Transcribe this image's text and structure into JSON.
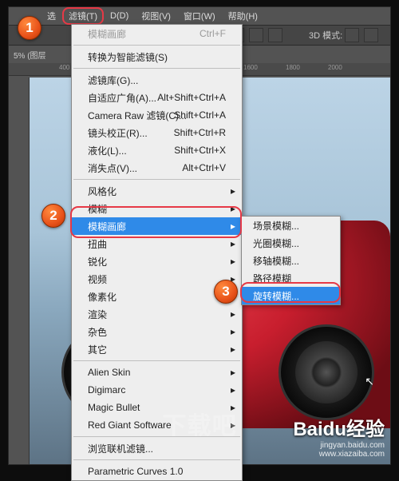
{
  "menubar": {
    "xuan": "选",
    "filter": "滤镜(T)",
    "d": "D(D)",
    "view": "视图(V)",
    "window": "窗口(W)",
    "help": "帮助(H)"
  },
  "toolbar": {
    "mode3d": "3D 模式:"
  },
  "infobar": {
    "zoom": "5% (图层",
    "layer": ""
  },
  "ruler": {
    "t1": "400",
    "t2": "1600",
    "t3": "1800",
    "t4": "2000"
  },
  "menu": {
    "blur_gallery": "模糊画廊",
    "blur_gallery_kb": "Ctrl+F",
    "smart": "转换为智能滤镜(S)",
    "lib": "滤镜库(G)...",
    "wide": "自适应广角(A)...",
    "wide_kb": "Alt+Shift+Ctrl+A",
    "raw": "Camera Raw 滤镜(C)...",
    "raw_kb": "Shift+Ctrl+A",
    "lens": "镜头校正(R)...",
    "lens_kb": "Shift+Ctrl+R",
    "liquify": "液化(L)...",
    "liquify_kb": "Shift+Ctrl+X",
    "vanish": "消失点(V)...",
    "vanish_kb": "Alt+Ctrl+V",
    "stylize": "风格化",
    "blur": "模糊",
    "blur_gal": "模糊画廊",
    "distort": "扭曲",
    "sharpen": "锐化",
    "video": "视频",
    "pixelate": "像素化",
    "render": "渲染",
    "noise": "杂色",
    "other": "其它",
    "alien": "Alien Skin",
    "digimarc": "Digimarc",
    "magic": "Magic Bullet",
    "redgiant": "Red Giant Software",
    "browse": "浏览联机滤镜...",
    "param": "Parametric Curves 1.0"
  },
  "submenu": {
    "field": "场景模糊...",
    "iris": "光圈模糊...",
    "tilt": "移轴模糊...",
    "path": "路径模糊",
    "spin": "旋转模糊..."
  },
  "badges": {
    "b1": "1",
    "b2": "2",
    "b3": "3"
  },
  "watermark": {
    "logo": "下载吧",
    "sub": "www.xiazaiba.com",
    "baidu": "Baidu经验",
    "baidu_sub": "jingyan.baidu.com"
  }
}
